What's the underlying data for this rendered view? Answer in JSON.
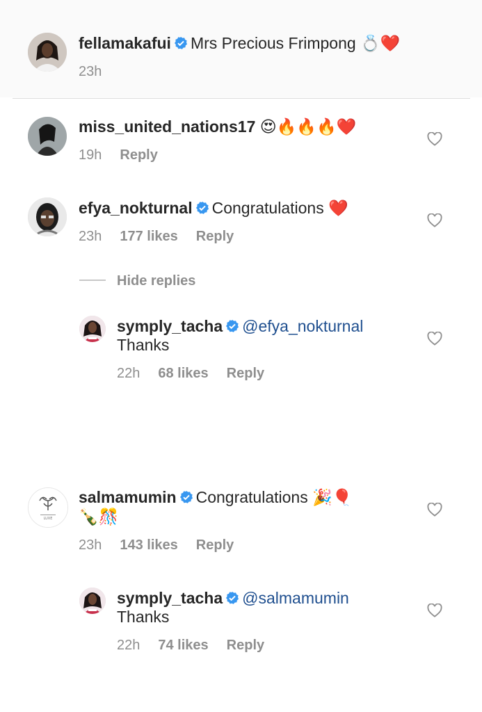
{
  "caption": {
    "username": "fellamakafui",
    "text": "Mrs Precious Frimpong",
    "emojis": "💍❤️",
    "time": "23h"
  },
  "comments": [
    {
      "username": "miss_united_nations17",
      "text": "",
      "emojis": "😍🔥🔥🔥❤️",
      "time": "19h",
      "reply_label": "Reply"
    },
    {
      "username": "efya_nokturnal",
      "text": "Congratulations",
      "emojis": "❤️",
      "time": "23h",
      "likes": "177 likes",
      "reply_label": "Reply"
    },
    {
      "username": "salmamumin",
      "text": "Congratulations",
      "emojis": "🎉🎈",
      "emojis2": "🍾🎊",
      "time": "23h",
      "likes": "143 likes",
      "reply_label": "Reply"
    }
  ],
  "hide_replies_label": "Hide replies",
  "replies": [
    {
      "username": "symply_tacha",
      "mention": "@efya_nokturnal",
      "text": "Thanks",
      "time": "22h",
      "likes": "68 likes",
      "reply_label": "Reply"
    },
    {
      "username": "symply_tacha",
      "mention": "@salmamumin",
      "text": "Thanks",
      "time": "22h",
      "likes": "74 likes",
      "reply_label": "Reply"
    }
  ],
  "colors": {
    "verified": "#3897f0",
    "meta": "#8e8e8e",
    "text": "#262626"
  },
  "icons": {
    "verified": "verified-badge-icon",
    "like": "heart-outline-icon"
  }
}
